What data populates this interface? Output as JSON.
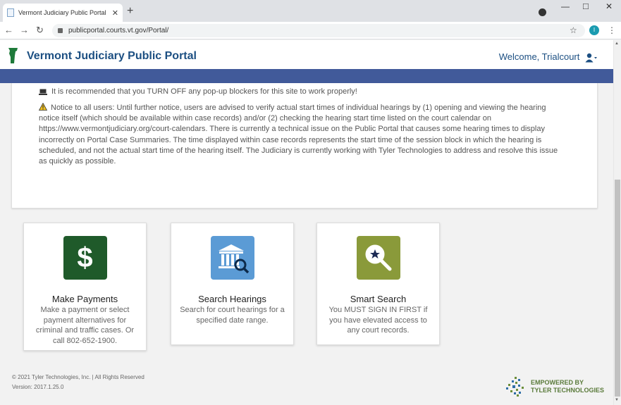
{
  "browser": {
    "tab_title": "Vermont Judiciary Public Portal",
    "tab_close": "✕",
    "new_tab": "+",
    "url": "publicportal.courts.vt.gov/Portal/",
    "profile_initial": "I"
  },
  "header": {
    "title": "Vermont Judiciary Public Portal",
    "welcome": "Welcome, Trialcourt"
  },
  "notices": {
    "popup": "It is recommended that you TURN OFF any pop-up blockers for this site to work properly!",
    "hearing": "Notice to all users: Until further notice, users are advised to verify actual start times of individual hearings by (1) opening and viewing the hearing notice itself (which should be available within case records) and/or (2) checking the hearing start time listed on the court calendar on https://www.vermontjudiciary.org/court-calendars. There is currently a technical issue on the Public Portal that causes some hearing times to display incorrectly on Portal Case Summaries. The time displayed within case records represents the start time of the session block in which the hearing is scheduled, and not the actual start time of the hearing itself. The Judiciary is currently working with Tyler Technologies to address and resolve this issue as quickly as possible."
  },
  "cards": [
    {
      "title": "Make Payments",
      "desc": "Make a payment or select payment alternatives for criminal and traffic cases. Or call 802-652-1900.",
      "icon": "dollar-icon",
      "color": "#1f5a2a"
    },
    {
      "title": "Search Hearings",
      "desc": "Search for court hearings for a specified date range.",
      "icon": "courthouse-search-icon",
      "color": "#5b9bd5"
    },
    {
      "title": "Smart Search",
      "desc": "You MUST SIGN IN FIRST if you have elevated access to any court records.",
      "icon": "magnifier-star-icon",
      "color": "#8a9a3a"
    }
  ],
  "footer": {
    "copyright": "© 2021 Tyler Technologies, Inc. | All Rights Reserved",
    "version": "Version: 2017.1.25.0",
    "brand_line1": "EMPOWERED BY",
    "brand_line2": "TYLER TECHNOLOGIES"
  }
}
